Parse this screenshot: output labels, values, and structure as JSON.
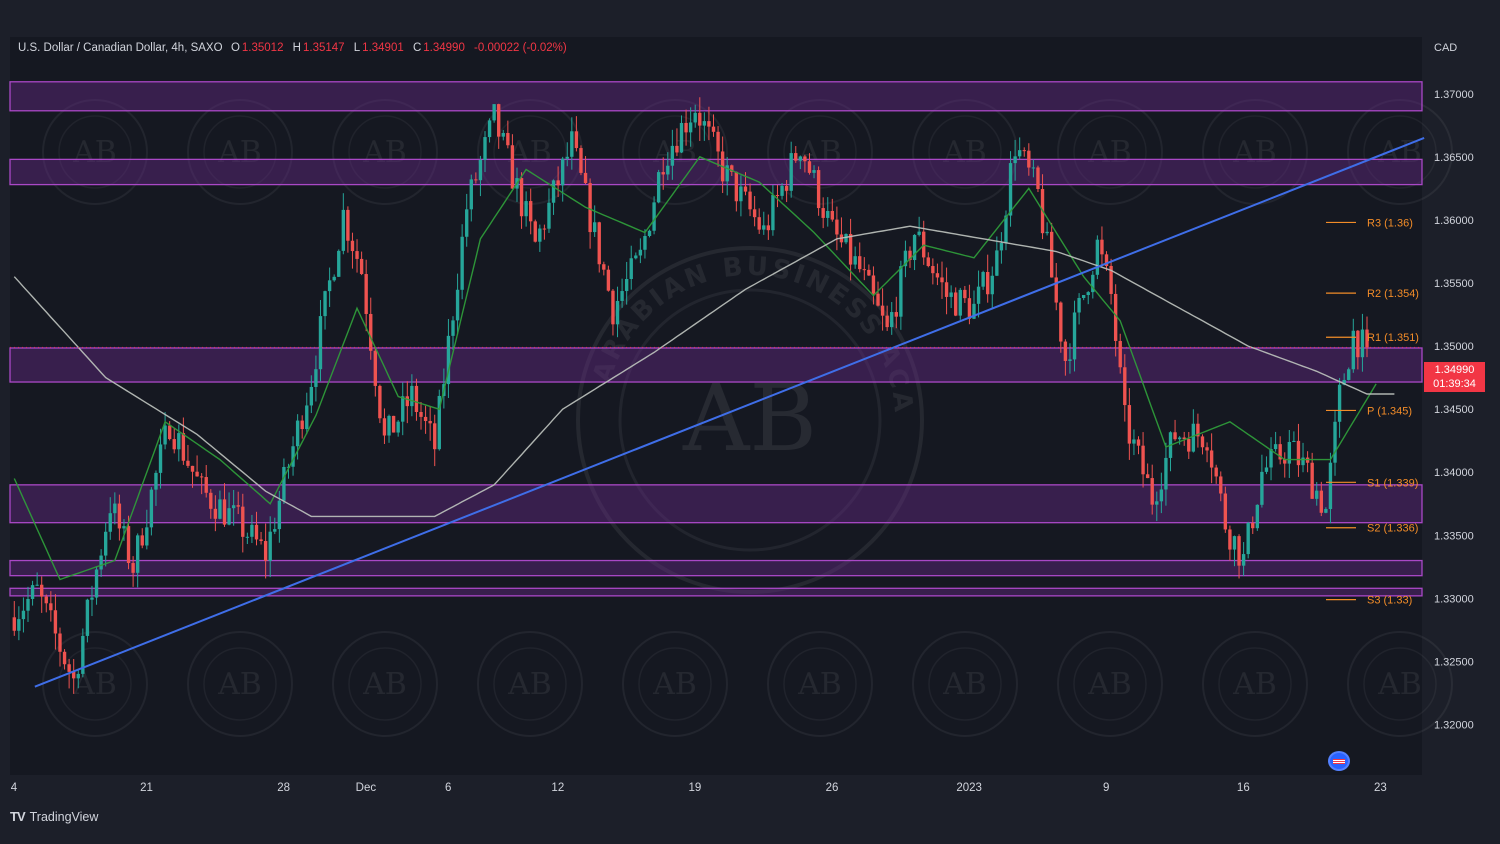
{
  "header": {
    "symbol": "U.S. Dollar / Canadian Dollar, 4h, SAXO",
    "open_label": "O",
    "open": "1.35012",
    "high_label": "H",
    "high": "1.35147",
    "low_label": "L",
    "low": "1.34901",
    "close_label": "C",
    "close": "1.34990",
    "change": "-0.00022 (-0.02%)"
  },
  "currency": "CAD",
  "price_tag": {
    "price": "1.34990",
    "timer": "01:39:34"
  },
  "footer": {
    "logo": "TV",
    "brand": "TradingView"
  },
  "watermark": {
    "main": "AB",
    "ring": "ARABIAN BUSINESS ACADEMY"
  },
  "colors": {
    "background": "#1c1f29",
    "up": "#26a69a",
    "down": "#ef5350",
    "zone_fill": "#6a2c8a",
    "zone_edge": "#b84dd6",
    "trendline": "#3f6ee8",
    "ma_fast": "#2e9b3a",
    "ma_slow": "#b7bdb8",
    "pivot": "#f28c28"
  },
  "chart_data": {
    "type": "candlestick",
    "title": "U.S. Dollar / Canadian Dollar, 4h, SAXO",
    "timeframe": "4h",
    "ylim": [
      1.316,
      1.3745
    ],
    "y_ticks": [
      1.37,
      1.365,
      1.36,
      1.355,
      1.35,
      1.345,
      1.34,
      1.335,
      1.33,
      1.325,
      1.32
    ],
    "y_tick_labels": [
      "1.37000",
      "1.36500",
      "1.36000",
      "1.35500",
      "1.35000",
      "1.34500",
      "1.34000",
      "1.33500",
      "1.33000",
      "1.32500",
      "1.32000"
    ],
    "x_ticks": [
      {
        "label": "4",
        "bar": 0
      },
      {
        "label": "21",
        "bar": 29
      },
      {
        "label": "28",
        "bar": 59
      },
      {
        "label": "Dec",
        "bar": 77
      },
      {
        "label": "6",
        "bar": 95
      },
      {
        "label": "12",
        "bar": 119
      },
      {
        "label": "19",
        "bar": 149
      },
      {
        "label": "26",
        "bar": 179
      },
      {
        "label": "2023",
        "bar": 209
      },
      {
        "label": "9",
        "bar": 239
      },
      {
        "label": "16",
        "bar": 269
      },
      {
        "label": "23",
        "bar": 299
      }
    ],
    "total_bars": 310,
    "key_points": [
      [
        0,
        1.3285
      ],
      [
        6,
        1.3305
      ],
      [
        14,
        1.3235
      ],
      [
        22,
        1.3375
      ],
      [
        27,
        1.3325
      ],
      [
        35,
        1.344
      ],
      [
        42,
        1.3385
      ],
      [
        50,
        1.336
      ],
      [
        56,
        1.3335
      ],
      [
        62,
        1.342
      ],
      [
        66,
        1.3475
      ],
      [
        73,
        1.3605
      ],
      [
        77,
        1.356
      ],
      [
        82,
        1.3425
      ],
      [
        88,
        1.346
      ],
      [
        93,
        1.342
      ],
      [
        100,
        1.361
      ],
      [
        106,
        1.368
      ],
      [
        115,
        1.358
      ],
      [
        123,
        1.366
      ],
      [
        132,
        1.353
      ],
      [
        138,
        1.357
      ],
      [
        143,
        1.365
      ],
      [
        150,
        1.369
      ],
      [
        156,
        1.364
      ],
      [
        165,
        1.359
      ],
      [
        173,
        1.366
      ],
      [
        180,
        1.359
      ],
      [
        186,
        1.356
      ],
      [
        192,
        1.351
      ],
      [
        198,
        1.359
      ],
      [
        205,
        1.354
      ],
      [
        211,
        1.353
      ],
      [
        216,
        1.357
      ],
      [
        220,
        1.366
      ],
      [
        225,
        1.362
      ],
      [
        231,
        1.349
      ],
      [
        238,
        1.358
      ],
      [
        241,
        1.354
      ],
      [
        244,
        1.344
      ],
      [
        250,
        1.338
      ],
      [
        255,
        1.343
      ],
      [
        262,
        1.343
      ],
      [
        266,
        1.336
      ],
      [
        270,
        1.333
      ],
      [
        274,
        1.34
      ],
      [
        280,
        1.342
      ],
      [
        284,
        1.34
      ],
      [
        288,
        1.337
      ],
      [
        291,
        1.346
      ],
      [
        294,
        1.351
      ],
      [
        296,
        1.35
      ]
    ],
    "resistance_support_zones": [
      [
        1.36865,
        1.37095
      ],
      [
        1.3628,
        1.3648
      ],
      [
        1.34715,
        1.34985
      ],
      [
        1.336,
        1.339
      ],
      [
        1.3318,
        1.333
      ],
      [
        1.3302,
        1.3308
      ]
    ],
    "trendline": {
      "from": [
        5,
        1.323
      ],
      "to": [
        309,
        1.3665
      ]
    },
    "moving_averages": [
      {
        "key_points": [
          [
            0,
            1.3395
          ],
          [
            10,
            1.3315
          ],
          [
            22,
            1.333
          ],
          [
            33,
            1.344
          ],
          [
            45,
            1.341
          ],
          [
            56,
            1.3375
          ],
          [
            66,
            1.3445
          ],
          [
            75,
            1.353
          ],
          [
            84,
            1.346
          ],
          [
            93,
            1.345
          ],
          [
            102,
            1.3585
          ],
          [
            112,
            1.364
          ],
          [
            125,
            1.361
          ],
          [
            138,
            1.359
          ],
          [
            150,
            1.365
          ],
          [
            163,
            1.363
          ],
          [
            175,
            1.359
          ],
          [
            188,
            1.354
          ],
          [
            199,
            1.358
          ],
          [
            210,
            1.357
          ],
          [
            222,
            1.3625
          ],
          [
            234,
            1.3555
          ],
          [
            242,
            1.352
          ],
          [
            252,
            1.342
          ],
          [
            266,
            1.344
          ],
          [
            278,
            1.341
          ],
          [
            288,
            1.341
          ],
          [
            298,
            1.347
          ]
        ]
      },
      {
        "key_points": [
          [
            0,
            1.3555
          ],
          [
            20,
            1.3475
          ],
          [
            40,
            1.343
          ],
          [
            55,
            1.3385
          ],
          [
            65,
            1.3365
          ],
          [
            80,
            1.3365
          ],
          [
            92,
            1.3365
          ],
          [
            105,
            1.339
          ],
          [
            120,
            1.345
          ],
          [
            140,
            1.3495
          ],
          [
            160,
            1.3545
          ],
          [
            180,
            1.3585
          ],
          [
            196,
            1.3595
          ],
          [
            212,
            1.3585
          ],
          [
            228,
            1.3575
          ],
          [
            240,
            1.356
          ],
          [
            255,
            1.353
          ],
          [
            270,
            1.35
          ],
          [
            285,
            1.348
          ],
          [
            296,
            1.3462
          ],
          [
            302,
            1.3462
          ]
        ]
      }
    ],
    "pivot_levels": [
      {
        "label": "R3 (1.36)",
        "value": 1.3598
      },
      {
        "label": "R2 (1.354)",
        "value": 1.3542
      },
      {
        "label": "R1 (1.351)",
        "value": 1.3507
      },
      {
        "label": "P (1.345)",
        "value": 1.3449
      },
      {
        "label": "S1 (1.339)",
        "value": 1.3392
      },
      {
        "label": "S2 (1.336)",
        "value": 1.3356
      },
      {
        "label": "S3 (1.33)",
        "value": 1.3299
      }
    ],
    "last_price": 1.3499
  }
}
